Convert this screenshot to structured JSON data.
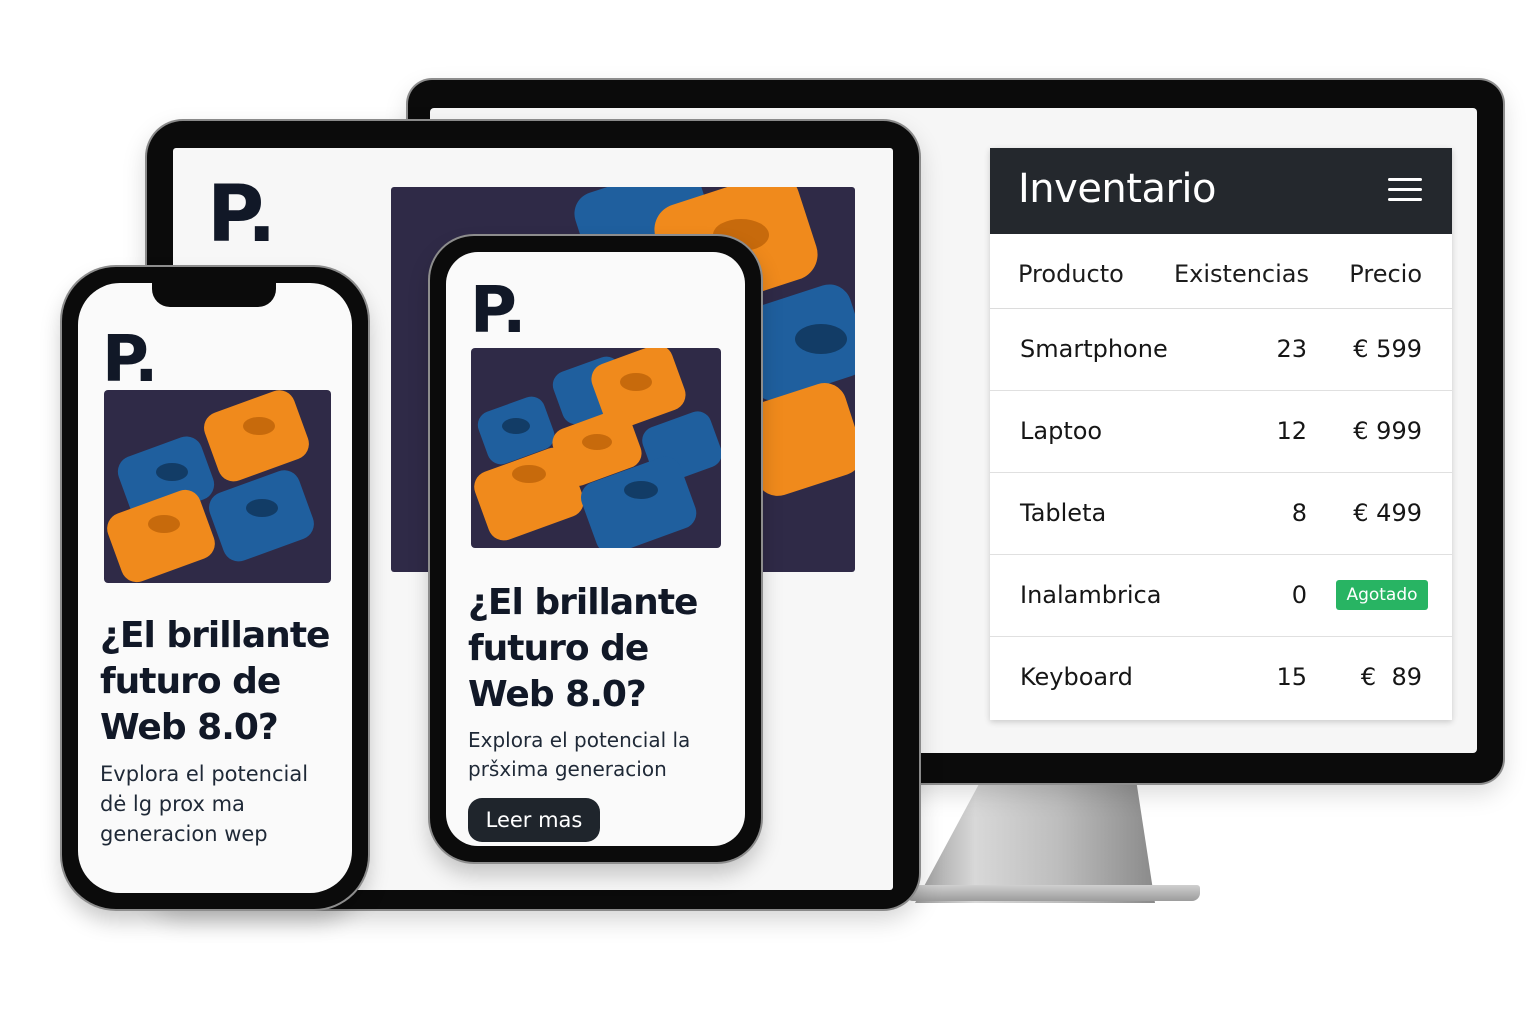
{
  "brand": {
    "logo": "P."
  },
  "inventory": {
    "title": "Inventario",
    "menu_icon": "hamburger-menu-icon",
    "columns": [
      "Producto",
      "Existencias",
      "Precio"
    ],
    "rows": [
      {
        "product": "Smartphone",
        "stock": "23",
        "price": "€ 599"
      },
      {
        "product": "Laptoo",
        "stock": "12",
        "price": "€ 999"
      },
      {
        "product": "Tableta",
        "stock": "8",
        "price": "€ 499"
      },
      {
        "product": "Inalambrica",
        "stock": "0",
        "badge": "Agotado"
      },
      {
        "product": "Keyboard",
        "stock": "15",
        "price": "€  89"
      }
    ],
    "badge_color": "#28b463",
    "header_color": "#24282d"
  },
  "phone_small": {
    "headline": [
      "¿El brillante",
      "futuro de",
      "Web 8.0?"
    ],
    "subtext": [
      "Evplora el potencial",
      "dė lg prox ma",
      "generacion wep"
    ]
  },
  "phone_large": {
    "headline": [
      "¿El brillante",
      "futuro de",
      "Web 8.0?"
    ],
    "subtext": [
      "Explora el potencial la",
      "pršxima generacion"
    ],
    "button_label": "Leer mas"
  },
  "colors": {
    "artwork_bg": "#2f2a47",
    "block_orange": "#f08a1c",
    "block_blue": "#1f5f9e"
  }
}
